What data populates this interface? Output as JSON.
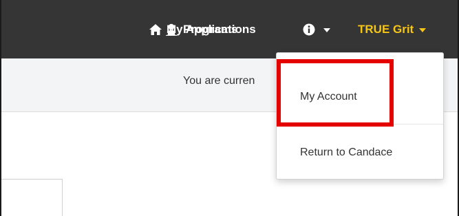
{
  "navbar": {
    "programs_label": "Programs",
    "programs_icon": "people-icon",
    "applications_label": "My Applications",
    "applications_icon": "home-icon",
    "info_icon": "info-icon",
    "user_label": "TRUE Grit",
    "user_color": "#f5c518",
    "background": "#353535"
  },
  "notice": {
    "text": "You are curren"
  },
  "dropdown": {
    "items": [
      {
        "label": "My Account"
      },
      {
        "label": "Return to Candace"
      }
    ]
  },
  "highlight": {
    "color": "#e50000",
    "target": "My Account"
  }
}
